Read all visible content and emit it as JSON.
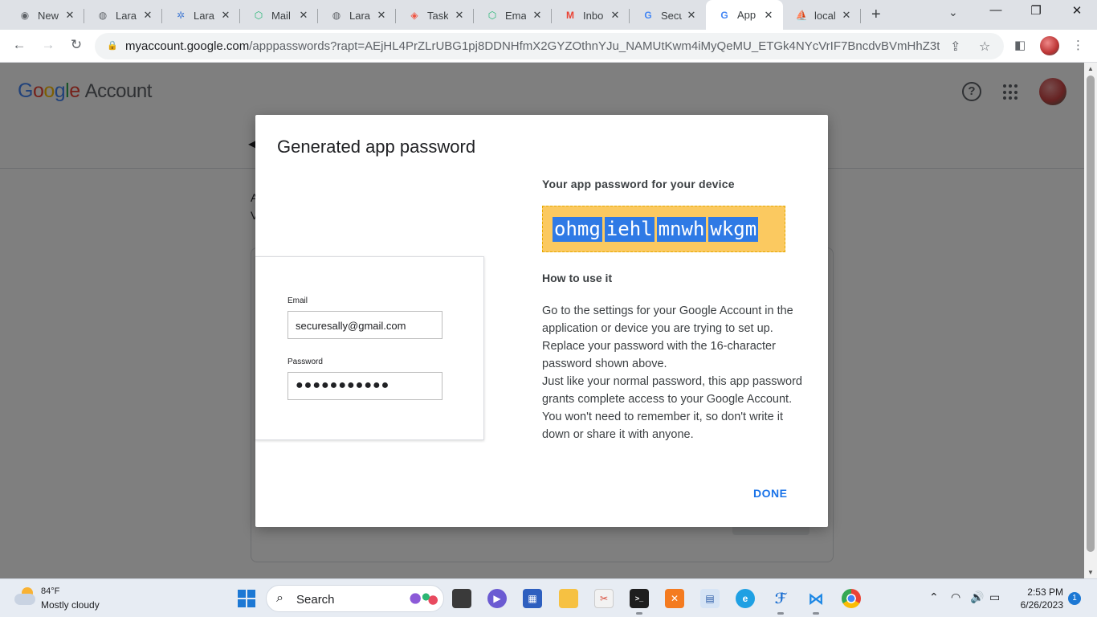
{
  "tabs": [
    {
      "title": "New",
      "icon": "chrome-icon"
    },
    {
      "title": "Lara",
      "icon": "globe-icon"
    },
    {
      "title": "Lara",
      "icon": "gear-icon"
    },
    {
      "title": "Mail",
      "icon": "mailtrap-icon"
    },
    {
      "title": "Lara",
      "icon": "globe-icon"
    },
    {
      "title": "Task",
      "icon": "laravel-icon"
    },
    {
      "title": "Emai",
      "icon": "mailtrap-icon"
    },
    {
      "title": "Inbo",
      "icon": "gmail-icon"
    },
    {
      "title": "Secu",
      "icon": "google-icon"
    },
    {
      "title": "App",
      "icon": "google-icon",
      "active": true
    },
    {
      "title": "local",
      "icon": "phpmyadmin-icon"
    }
  ],
  "browser": {
    "url_host": "myaccount.google.com",
    "url_path": "/apppasswords?rapt=AEjHL4PrZLrUBG1pj8DDNHfmX2GYZOthnYJu_NAMUtKwm4iMyQeMU_ETGk4NYcVrIF7BncdvBVmHhZ3t..."
  },
  "page": {
    "brand": "Google",
    "brand_suffix": "Account"
  },
  "dialog": {
    "title": "Generated app password",
    "illustration": {
      "email_label": "Email",
      "email_value": "securesally@gmail.com",
      "password_label": "Password",
      "password_value": "●●●●●●●●●●●"
    },
    "password_label": "Your app password for your device",
    "password_chunks": [
      "ohmg",
      "iehl",
      "mnwh",
      "wkgm"
    ],
    "how_title": "How to use it",
    "how_body_1": "Go to the settings for your Google Account in the application or device you are trying to set up. Replace your password with the 16-character password shown above.",
    "how_body_2": "Just like your normal password, this app password grants complete access to your Google Account. You won't need to remember it, so don't write it down or share it with anyone.",
    "done_label": "DONE"
  },
  "taskbar": {
    "temperature": "84°F",
    "weather": "Mostly cloudy",
    "search_label": "Search",
    "time": "2:53 PM",
    "date": "6/26/2023",
    "notifications": "1"
  },
  "colors": {
    "accent": "#1a73e8",
    "password_highlight": "#fbc960",
    "selection": "#2f7ae5",
    "taskbar": "#e7ecf3"
  }
}
